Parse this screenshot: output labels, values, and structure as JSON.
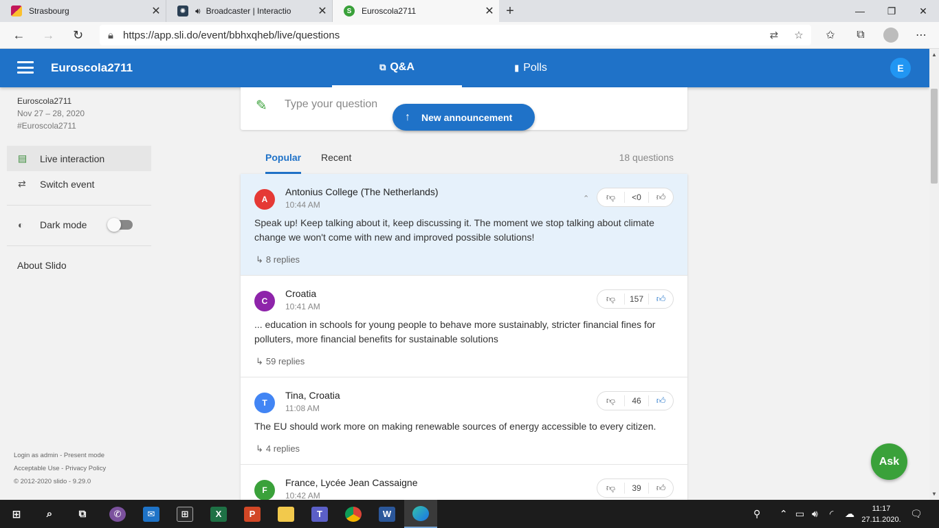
{
  "browser": {
    "tabs": [
      {
        "title": "Strasbourg",
        "active": false,
        "favicon_color": "#c2185b"
      },
      {
        "title": "Broadcaster | Interactio",
        "active": false,
        "favicon_color": "#2a3f54"
      },
      {
        "title": "Euroscola2711",
        "active": true,
        "favicon_color": "#3aa13a",
        "favicon_letter": "S"
      }
    ],
    "url": "https://app.sli.do/event/bbhxqheb/live/questions"
  },
  "header": {
    "event_name": "Euroscola2711",
    "tabs": [
      {
        "label": "Q&A",
        "active": true
      },
      {
        "label": "Polls",
        "active": false
      }
    ],
    "user_initial": "E"
  },
  "sidebar": {
    "event_name": "Euroscola2711",
    "event_dates": "Nov 27 – 28, 2020",
    "event_hashtag": "#Euroscola2711",
    "items": [
      {
        "label": "Live interaction",
        "active": true
      },
      {
        "label": "Switch event",
        "active": false
      }
    ],
    "dark_mode_label": "Dark mode",
    "dark_mode_on": false,
    "about_label": "About Slido",
    "footer": {
      "login": "Login as admin",
      "present": "Present mode",
      "acceptable_use": "Acceptable Use",
      "privacy": "Privacy Policy",
      "copyright": "2012-2020 slido - 9.29.0"
    }
  },
  "ask": {
    "placeholder": "Type your question",
    "announcement_label": "New announcement"
  },
  "questions_tabs": {
    "popular": "Popular",
    "recent": "Recent",
    "count_label": "18 questions"
  },
  "questions": [
    {
      "initial": "A",
      "avatar_color": "#e53935",
      "author": "Antonius College (The Netherlands)",
      "time": "10:44 AM",
      "text_lines": [
        "Speak up! Keep talking about it, keep discussing it. The moment we stop talking about climate",
        "change we won't come with new and improved possible solutions!"
      ],
      "replies": "8 replies",
      "votes": "<0",
      "liked": false,
      "highlighted": true
    },
    {
      "initial": "C",
      "avatar_color": "#8e24aa",
      "author": "Croatia",
      "time": "10:41 AM",
      "text_lines": [
        "... education in schools for young people to behave more sustainably, stricter financial fines for",
        "polluters, more financial benefits for sustainable solutions"
      ],
      "replies": "59 replies",
      "votes": "157",
      "liked": true,
      "highlighted": false
    },
    {
      "initial": "T",
      "avatar_color": "#4285f4",
      "author": "Tina, Croatia",
      "time": "11:08 AM",
      "text_lines": [
        "The EU should work more on making renewable sources of energy accessible to every citizen."
      ],
      "replies": "4 replies",
      "votes": "46",
      "liked": true,
      "highlighted": false
    },
    {
      "initial": "F",
      "avatar_color": "#3aa13a",
      "author": "France, Lycée Jean Cassaigne",
      "time": "10:42 AM",
      "text_lines": [],
      "replies": "",
      "votes": "39",
      "liked": false,
      "highlighted": false
    }
  ],
  "fab_label": "Ask",
  "taskbar": {
    "time": "11:17",
    "date": "27.11.2020."
  }
}
